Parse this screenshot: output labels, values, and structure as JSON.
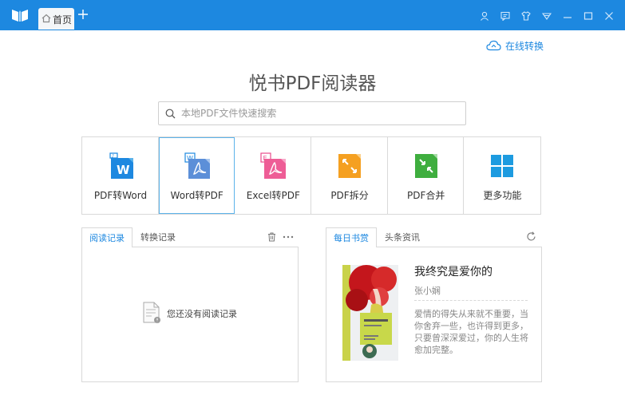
{
  "window": {
    "tab_label": "首页",
    "colors": {
      "titlebar": "#1d88e0",
      "accent": "#1d88e0"
    },
    "controls": [
      "user-icon",
      "message-icon",
      "skin-icon",
      "menu-icon",
      "minimize-icon",
      "maximize-icon",
      "close-icon"
    ]
  },
  "header": {
    "online_convert_label": "在线转换",
    "app_title": "悦书PDF阅读器"
  },
  "search": {
    "placeholder": "本地PDF文件快速搜索",
    "value": ""
  },
  "features": [
    {
      "label": "PDF转Word",
      "icon": "pdf-to-word-icon"
    },
    {
      "label": "Word转PDF",
      "icon": "word-to-pdf-icon"
    },
    {
      "label": "Excel转PDF",
      "icon": "excel-to-pdf-icon"
    },
    {
      "label": "PDF拆分",
      "icon": "pdf-split-icon"
    },
    {
      "label": "PDF合并",
      "icon": "pdf-merge-icon"
    },
    {
      "label": "更多功能",
      "icon": "more-features-icon"
    }
  ],
  "history": {
    "tabs": [
      "阅读记录",
      "转换记录"
    ],
    "empty_text": "您还没有阅读记录"
  },
  "recommend": {
    "tabs": [
      "每日书赏",
      "头条资讯"
    ],
    "book": {
      "title": "我终究是爱你的",
      "author": "张小娴",
      "description": "爱情的得失从来就不重要，当你舍弃一些，也许得到更多，只要曾深深爱过，你的人生将愈加完整。"
    }
  }
}
